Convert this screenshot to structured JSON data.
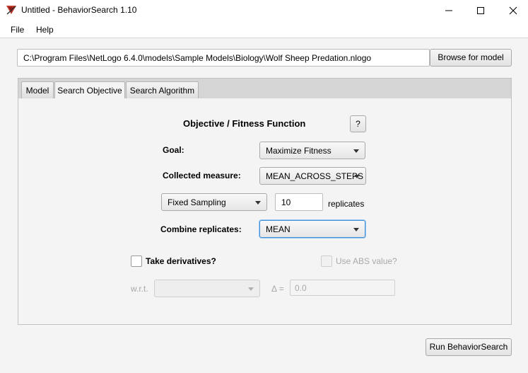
{
  "window": {
    "title": "Untitled - BehaviorSearch 1.10",
    "icon": "behaviorsearch-app-icon"
  },
  "menu": {
    "file": "File",
    "help": "Help"
  },
  "model": {
    "path": "C:\\Program Files\\NetLogo 6.4.0\\models\\Sample Models\\Biology\\Wolf Sheep Predation.nlogo",
    "browse_label": "Browse for model"
  },
  "tabs": [
    {
      "label": "Model",
      "active": false
    },
    {
      "label": "Search Objective",
      "active": true
    },
    {
      "label": "Search Algorithm",
      "active": false
    }
  ],
  "objective": {
    "heading": "Objective / Fitness Function",
    "help_label": "?",
    "goal_label": "Goal:",
    "goal_value": "Maximize Fitness",
    "measure_label": "Collected measure:",
    "measure_value": "MEAN_ACROSS_STEPS",
    "sampling_value": "Fixed Sampling",
    "replicates_value": "10",
    "replicates_label": "replicates",
    "combine_label": "Combine replicates:",
    "combine_value": "MEAN",
    "derivatives_label": "Take derivatives?",
    "derivatives_checked": false,
    "abs_label": "Use ABS value?",
    "abs_checked": false,
    "wrt_label": "w.r.t.",
    "wrt_value": "",
    "delta_label": "Δ =",
    "delta_value": "0.0"
  },
  "actions": {
    "run_label": "Run BehaviorSearch"
  },
  "colors": {
    "focus": "#3c8fd8",
    "disabled_text": "#a8a8a8",
    "background": "#f4f4f4"
  }
}
